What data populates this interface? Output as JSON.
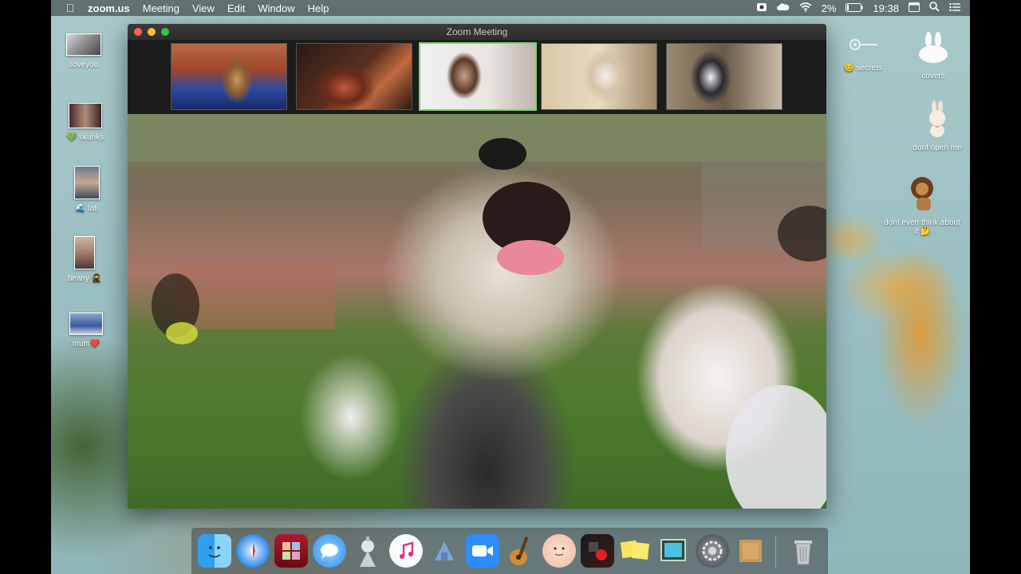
{
  "menubar": {
    "app_name": "zoom.us",
    "menus": [
      "Meeting",
      "View",
      "Edit",
      "Window",
      "Help"
    ],
    "battery": "2%",
    "time": "19:38"
  },
  "desktop_left": [
    {
      "label": "iloveyou"
    },
    {
      "label": "💚 skunks"
    },
    {
      "label": "🌊 tati"
    },
    {
      "label": "beany 🥷"
    },
    {
      "label": "mum❤️"
    }
  ],
  "desktop_right": [
    {
      "label": "😊 secrets"
    },
    {
      "label": "covers"
    },
    {
      "label": "dont open me"
    },
    {
      "label": "dont even think about it 🤔"
    }
  ],
  "zoom_window": {
    "title": "Zoom Meeting",
    "participant_count": 5,
    "active_tile": 3
  },
  "dock": {
    "apps": [
      "finder-icon",
      "safari-icon",
      "photo-booth-icon",
      "messages-icon",
      "launchpad-icon",
      "music-icon",
      "app-store-icon",
      "zoom-icon",
      "garageband-icon",
      "face-app-icon",
      "photo-app-icon",
      "notes-icon",
      "preview-icon",
      "system-preferences-icon",
      "folder-icon",
      "trash-icon"
    ]
  }
}
